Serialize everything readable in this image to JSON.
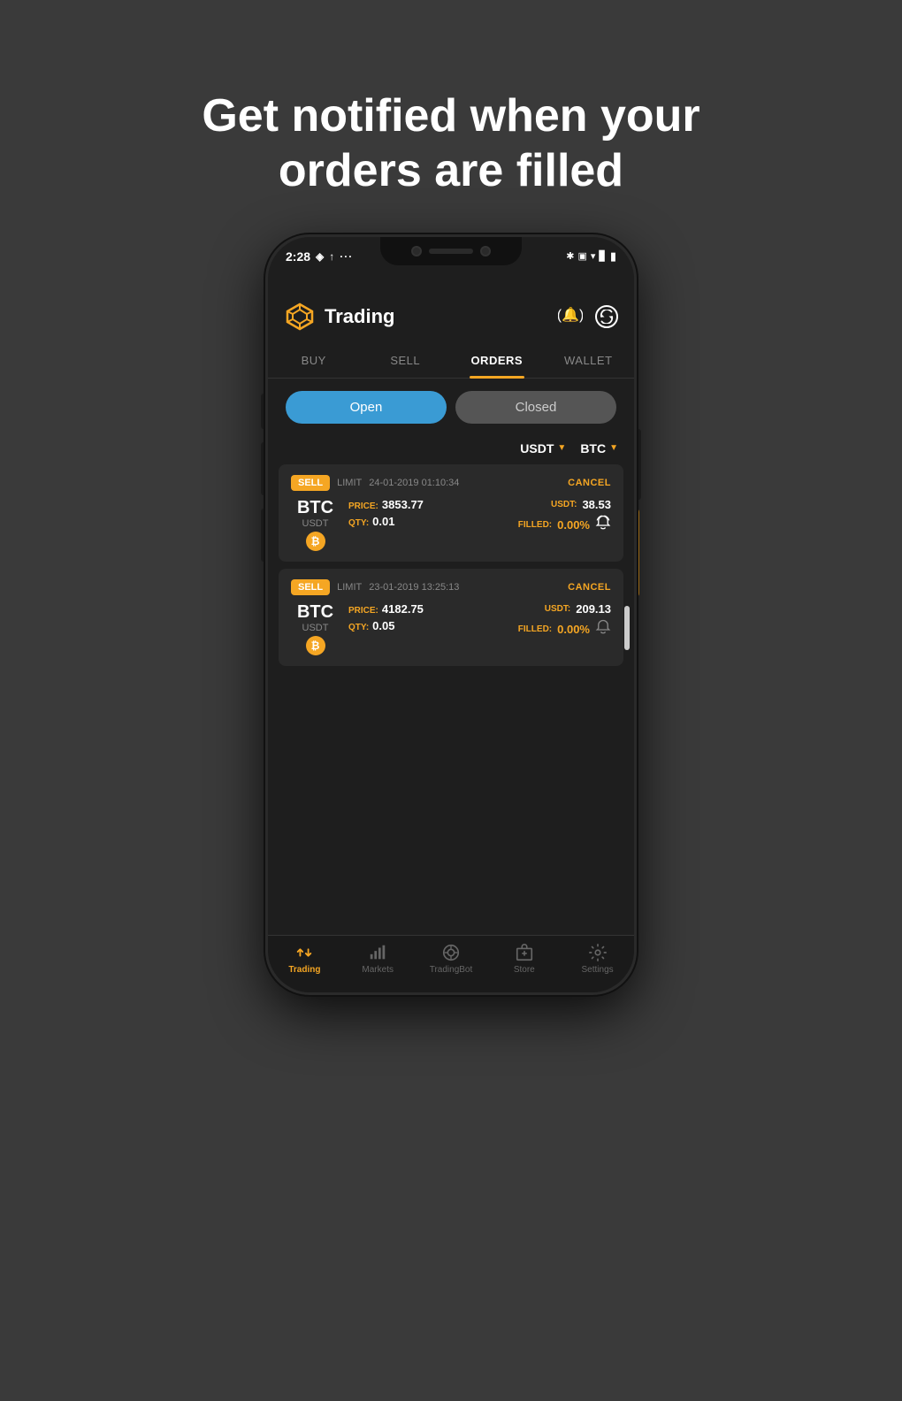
{
  "headline": {
    "line1": "Get notified when your",
    "line2": "orders are filled"
  },
  "phone": {
    "statusBar": {
      "time": "2:28",
      "icons_left": [
        "notification-icon",
        "upload-icon",
        "dots-icon"
      ],
      "icons_right": [
        "bluetooth-icon",
        "vibrate-icon",
        "wifi-icon",
        "signal-icon",
        "battery-icon"
      ]
    },
    "header": {
      "title": "Trading",
      "bell_label": "bell",
      "refresh_label": "refresh"
    },
    "tabs": [
      {
        "label": "BUY",
        "active": false
      },
      {
        "label": "SELL",
        "active": false
      },
      {
        "label": "ORDERS",
        "active": true
      },
      {
        "label": "WALLET",
        "active": false
      }
    ],
    "toggles": {
      "open_label": "Open",
      "closed_label": "Closed",
      "active": "open"
    },
    "filters": {
      "currency1": "USDT",
      "currency2": "BTC"
    },
    "orders": [
      {
        "type": "SELL",
        "order_type": "LIMIT",
        "date": "24-01-2019 01:10:34",
        "cancel_label": "CANCEL",
        "pair_base": "BTC",
        "pair_quote": "USDT",
        "price_label": "PRICE:",
        "price_value": "3853.77",
        "usdt_label": "USDT:",
        "usdt_value": "38.53",
        "qty_label": "QTY:",
        "qty_value": "0.01",
        "filled_label": "FILLED:",
        "filled_value": "0.00%",
        "bell_active": true
      },
      {
        "type": "SELL",
        "order_type": "LIMIT",
        "date": "23-01-2019 13:25:13",
        "cancel_label": "CANCEL",
        "pair_base": "BTC",
        "pair_quote": "USDT",
        "price_label": "PRICE:",
        "price_value": "4182.75",
        "usdt_label": "USDT:",
        "usdt_value": "209.13",
        "qty_label": "QTY:",
        "qty_value": "0.05",
        "filled_label": "FILLED:",
        "filled_value": "0.00%",
        "bell_active": false
      }
    ],
    "bottomNav": [
      {
        "label": "Trading",
        "active": true,
        "icon": "trading-icon"
      },
      {
        "label": "Markets",
        "active": false,
        "icon": "markets-icon"
      },
      {
        "label": "TradingBot",
        "active": false,
        "icon": "tradingbot-icon"
      },
      {
        "label": "Store",
        "active": false,
        "icon": "store-icon"
      },
      {
        "label": "Settings",
        "active": false,
        "icon": "settings-icon"
      }
    ]
  }
}
